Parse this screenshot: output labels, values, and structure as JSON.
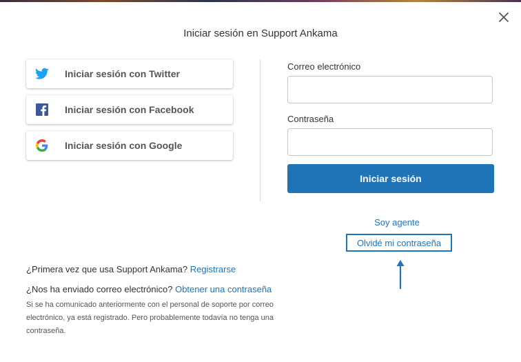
{
  "dialog": {
    "title": "Iniciar sesión en Support Ankama",
    "close_icon": "close-icon"
  },
  "social": [
    {
      "label": "Iniciar sesión con Twitter",
      "icon": "twitter-icon",
      "color": "#1da1f2"
    },
    {
      "label": "Iniciar sesión con Facebook",
      "icon": "facebook-icon",
      "color": "#3b5998"
    },
    {
      "label": "Iniciar sesión con Google",
      "icon": "google-icon",
      "color": "#4285f4"
    }
  ],
  "form": {
    "email_label": "Correo electrónico",
    "email_value": "",
    "password_label": "Contraseña",
    "password_value": "",
    "submit_label": "Iniciar sesión"
  },
  "links": {
    "agent": "Soy agente",
    "forgot": "Olvidé mi contraseña"
  },
  "footer": {
    "first_time_text": "¿Primera vez que usa Support Ankama?",
    "register_link": "Registrarse",
    "emailed_text": "¿Nos ha enviado correo electrónico?",
    "get_password_link": "Obtener una contraseña",
    "note": "Si se ha comunicado anteriormente con el personal de soporte por correo electrónico, ya está registrado. Pero probablemente todavía no tenga una contraseña."
  },
  "colors": {
    "accent": "#1f73b7"
  }
}
